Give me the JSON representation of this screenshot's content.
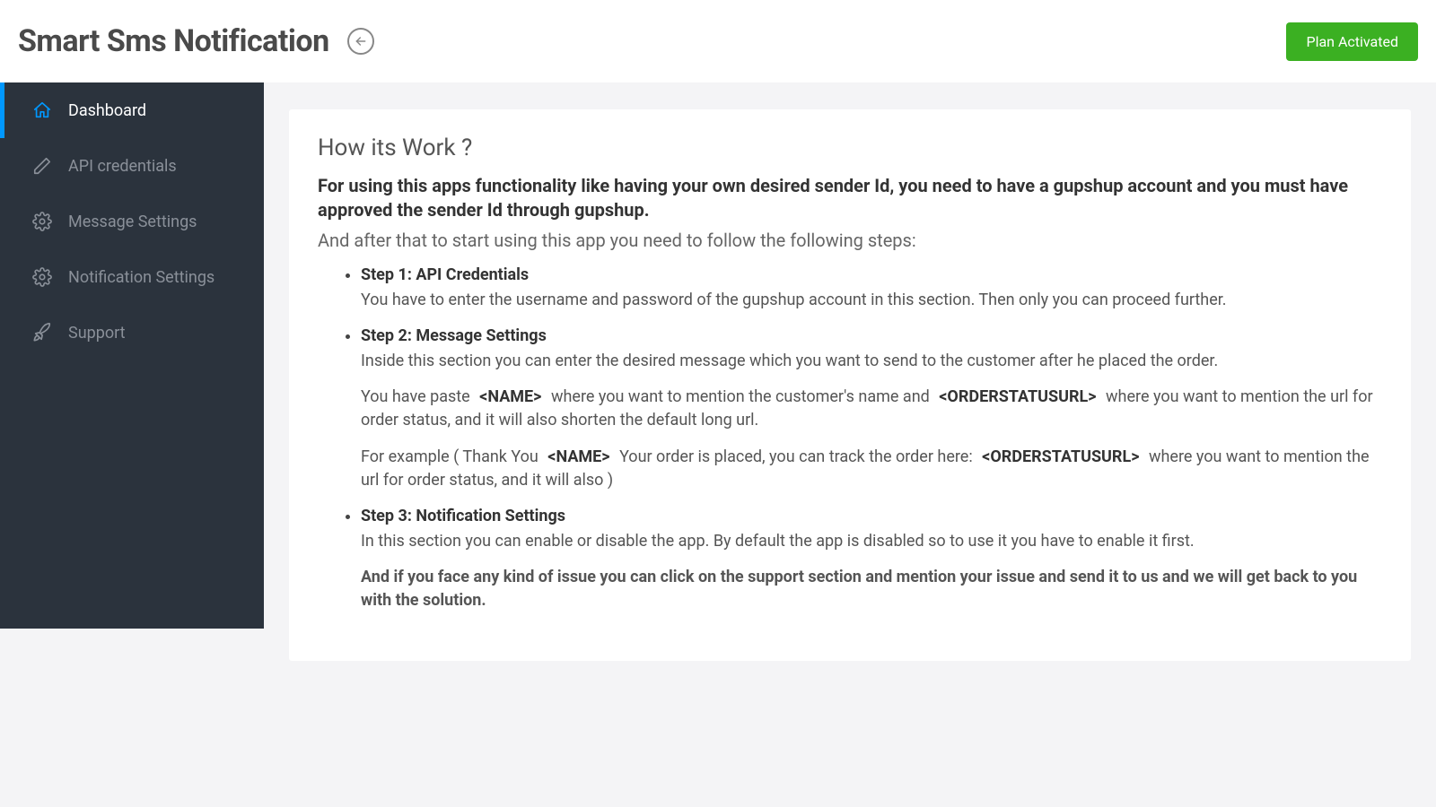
{
  "header": {
    "title": "Smart Sms Notification",
    "plan_badge": "Plan Activated"
  },
  "sidebar": {
    "items": [
      {
        "label": "Dashboard",
        "icon": "home"
      },
      {
        "label": "API credentials",
        "icon": "pencil"
      },
      {
        "label": "Message Settings",
        "icon": "gear"
      },
      {
        "label": "Notification Settings",
        "icon": "gear"
      },
      {
        "label": "Support",
        "icon": "rocket"
      }
    ]
  },
  "main": {
    "title": "How its Work ?",
    "intro_bold": "For using this apps functionality like having your own desired sender Id, you need to have a gupshup account and you must have approved the sender Id through gupshup.",
    "intro_sub": "And after that to start using this app you need to follow the following steps:",
    "steps": [
      {
        "title": "Step 1: API Credentials",
        "p1": "You have to enter the username and password of the gupshup account in this section. Then only you can proceed further."
      },
      {
        "title": "Step 2: Message Settings",
        "p1": "Inside this section you can enter the desired message which you want to send to the customer after he placed the order.",
        "p2a": "You have paste ",
        "p2_name": "<NAME>",
        "p2b": " where you want to mention the customer's name and ",
        "p2_order": "<ORDERSTATUSURL>",
        "p2c": " where you want to mention the url for order status, and it will also shorten the default long url.",
        "p3a": "For example ( Thank You ",
        "p3_name": "<NAME>",
        "p3b": " Your order is placed, you can track the order here: ",
        "p3_order": "<ORDERSTATUSURL>",
        "p3c": " where you want to mention the url for order status, and it will also )"
      },
      {
        "title": "Step 3: Notification Settings",
        "p1": "In this section you can enable or disable the app. By default the app is disabled so to use it you have to enable it first.",
        "support": "And if you face any kind of issue you can click on the support section and mention your issue and send it to us and we will get back to you with the solution."
      }
    ]
  }
}
